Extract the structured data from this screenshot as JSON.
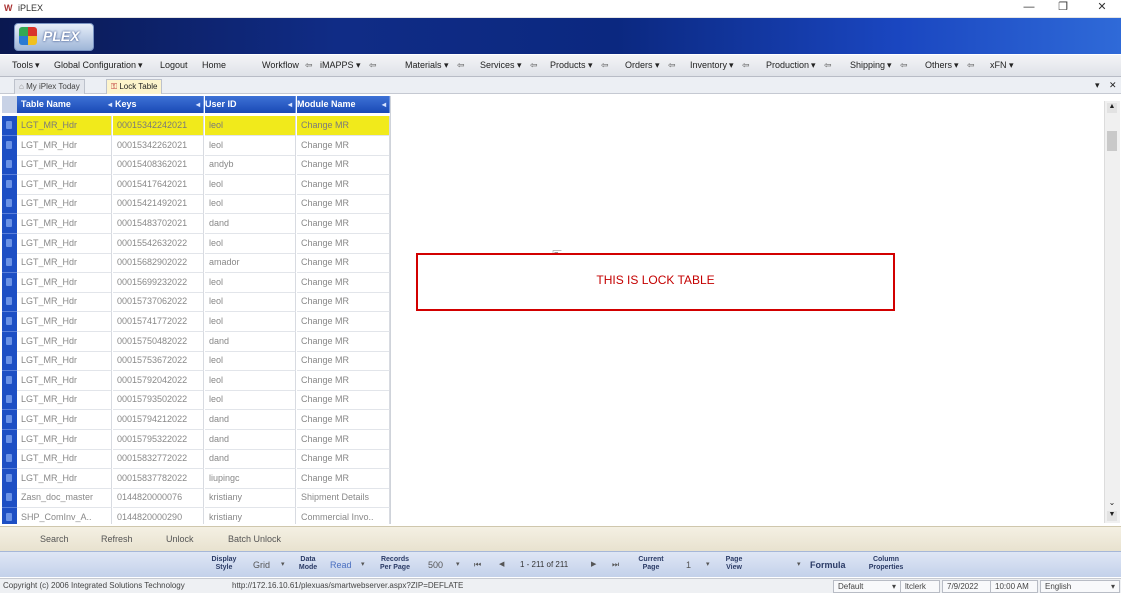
{
  "window": {
    "title": "iPLEX",
    "logo_mark": "W",
    "controls": [
      "—",
      "❐",
      "✕"
    ]
  },
  "brand": {
    "text": "PLEX"
  },
  "menubar": [
    {
      "label": "Tools",
      "dd": "▾"
    },
    {
      "label": "Global Configuration",
      "dd": "▾"
    },
    {
      "label": "Logout"
    },
    {
      "label": "Home"
    },
    {
      "label": "Workflow",
      "sep": "⇦"
    },
    {
      "label": "iMAPPS",
      "dd": "▾",
      "sep": "⇦"
    },
    {
      "label": "Materials",
      "dd": "▾",
      "sep": "⇦"
    },
    {
      "label": "Services",
      "dd": "▾",
      "sep": "⇦"
    },
    {
      "label": "Products",
      "dd": "▾",
      "sep": "⇦"
    },
    {
      "label": "Orders",
      "dd": "▾",
      "sep": "⇦"
    },
    {
      "label": "Inventory",
      "dd": "▾",
      "sep": "⇦"
    },
    {
      "label": "Production",
      "dd": "▾",
      "sep": "⇦"
    },
    {
      "label": "Shipping",
      "dd": "▾",
      "sep": "⇦"
    },
    {
      "label": "Others",
      "dd": "▾",
      "sep": "⇦"
    },
    {
      "label": "xFN",
      "dd": "▾"
    }
  ],
  "tabs": [
    {
      "label": "My iPlex Today"
    },
    {
      "label": "Lock Table",
      "active": true
    }
  ],
  "tab_controls": {
    "pin": "▾",
    "close": "✕"
  },
  "grid": {
    "columns": [
      "Table Name",
      "Keys",
      "User ID",
      "Module Name"
    ],
    "rows": [
      [
        "LGT_MR_Hdr",
        "00015342242021",
        "leol",
        "Change MR"
      ],
      [
        "LGT_MR_Hdr",
        "00015342262021",
        "leol",
        "Change MR"
      ],
      [
        "LGT_MR_Hdr",
        "00015408362021",
        "andyb",
        "Change MR"
      ],
      [
        "LGT_MR_Hdr",
        "00015417642021",
        "leol",
        "Change MR"
      ],
      [
        "LGT_MR_Hdr",
        "00015421492021",
        "leol",
        "Change MR"
      ],
      [
        "LGT_MR_Hdr",
        "00015483702021",
        "dand",
        "Change MR"
      ],
      [
        "LGT_MR_Hdr",
        "00015542632022",
        "leol",
        "Change MR"
      ],
      [
        "LGT_MR_Hdr",
        "00015682902022",
        "amador",
        "Change MR"
      ],
      [
        "LGT_MR_Hdr",
        "00015699232022",
        "leol",
        "Change MR"
      ],
      [
        "LGT_MR_Hdr",
        "00015737062022",
        "leol",
        "Change MR"
      ],
      [
        "LGT_MR_Hdr",
        "00015741772022",
        "leol",
        "Change MR"
      ],
      [
        "LGT_MR_Hdr",
        "00015750482022",
        "dand",
        "Change MR"
      ],
      [
        "LGT_MR_Hdr",
        "00015753672022",
        "leol",
        "Change MR"
      ],
      [
        "LGT_MR_Hdr",
        "00015792042022",
        "leol",
        "Change MR"
      ],
      [
        "LGT_MR_Hdr",
        "00015793502022",
        "leol",
        "Change MR"
      ],
      [
        "LGT_MR_Hdr",
        "00015794212022",
        "dand",
        "Change MR"
      ],
      [
        "LGT_MR_Hdr",
        "00015795322022",
        "dand",
        "Change MR"
      ],
      [
        "LGT_MR_Hdr",
        "00015832772022",
        "dand",
        "Change MR"
      ],
      [
        "LGT_MR_Hdr",
        "00015837782022",
        "liupingc",
        "Change MR"
      ],
      [
        "Zasn_doc_master",
        "0144820000076",
        "kristiany",
        "Shipment Details"
      ],
      [
        "SHP_ComInv_A..",
        "0144820000290",
        "kristiany",
        "Commercial Invo.."
      ]
    ]
  },
  "note": {
    "text": "THIS IS LOCK TABLE"
  },
  "actions": [
    "Search",
    "Refresh",
    "Unlock",
    "Batch Unlock"
  ],
  "paging": {
    "display_style_label": [
      "Display",
      "Style"
    ],
    "display_style_value": "Grid",
    "data_mode_label": [
      "Data",
      "Mode"
    ],
    "data_mode_value": "Read",
    "records_label": [
      "Records",
      "Per Page"
    ],
    "records_value": "500",
    "range": "1 - 211 of 211",
    "current_page_label": [
      "Current",
      "Page"
    ],
    "current_page_value": "1",
    "page_view_label": [
      "Page",
      "View"
    ],
    "formula": "Formula",
    "column_props_label": [
      "Column",
      "Properties"
    ],
    "first": "⏮",
    "prev": "◀",
    "next": "▶",
    "last": "⏭",
    "dd": "▾"
  },
  "status": {
    "copyright": "Copyright (c) 2006 Integrated Solutions Technology",
    "url": "http://172.16.10.61/plexuas/smartwebserver.aspx?ZIP=DEFLATE",
    "theme": "Default",
    "user": "ltclerk",
    "date": "7/9/2022",
    "time": "10:00 AM",
    "language": "English"
  }
}
